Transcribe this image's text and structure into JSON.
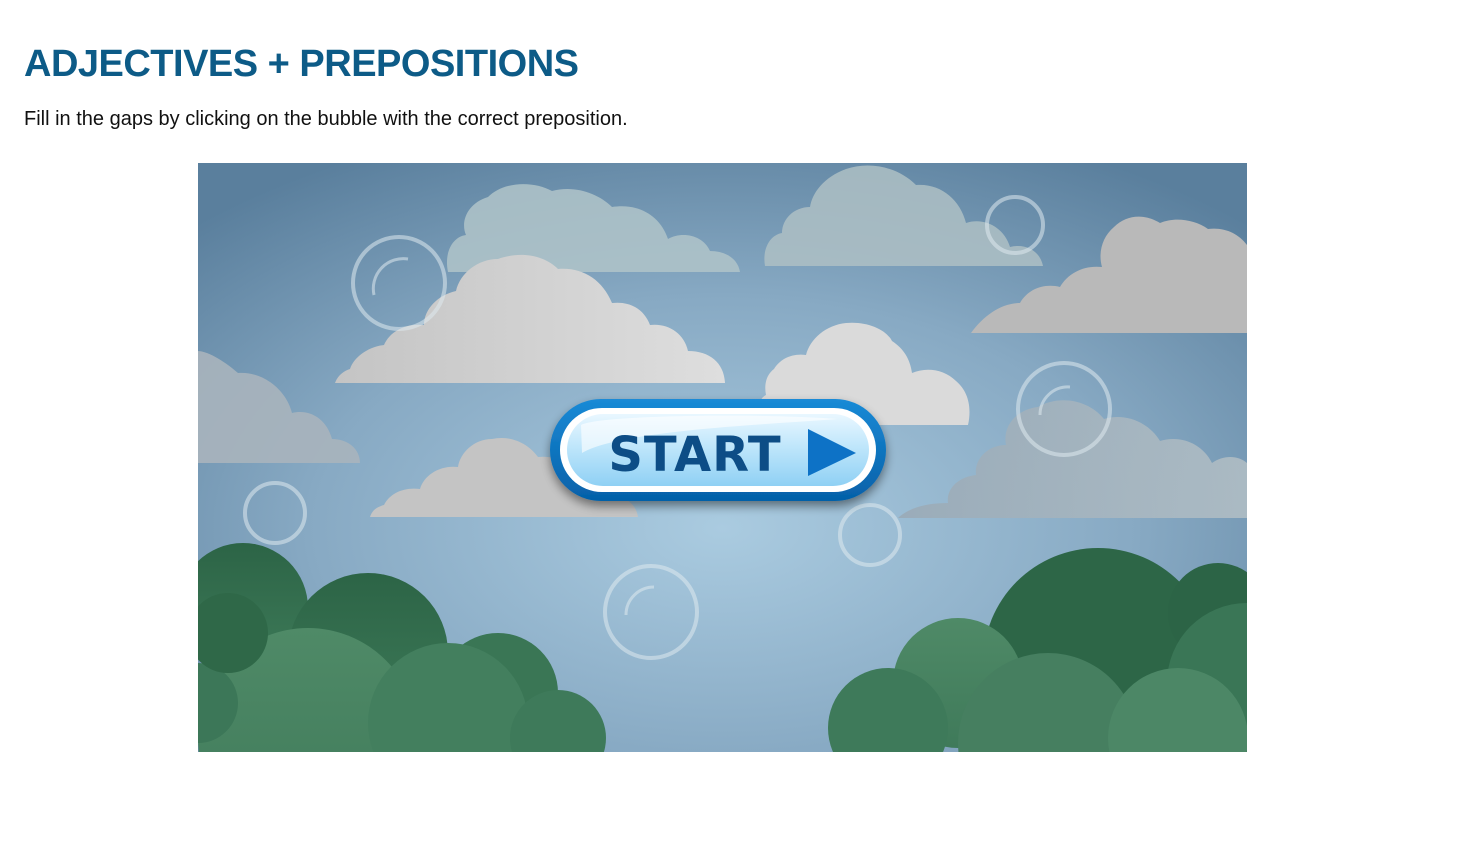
{
  "page": {
    "title": "ADJECTIVES + PREPOSITIONS",
    "instructions": "Fill in the gaps by clicking on the bubble with the correct preposition."
  },
  "game": {
    "start_label": "START",
    "start_icon": "play-triangle-icon",
    "colors": {
      "title": "#0d5b87",
      "sky_center": "#a8c9de",
      "sky_edge": "#5f85a3",
      "button_text": "#0b4e86",
      "button_ring": "#0a74c4",
      "foliage": "#2f6e48"
    }
  }
}
